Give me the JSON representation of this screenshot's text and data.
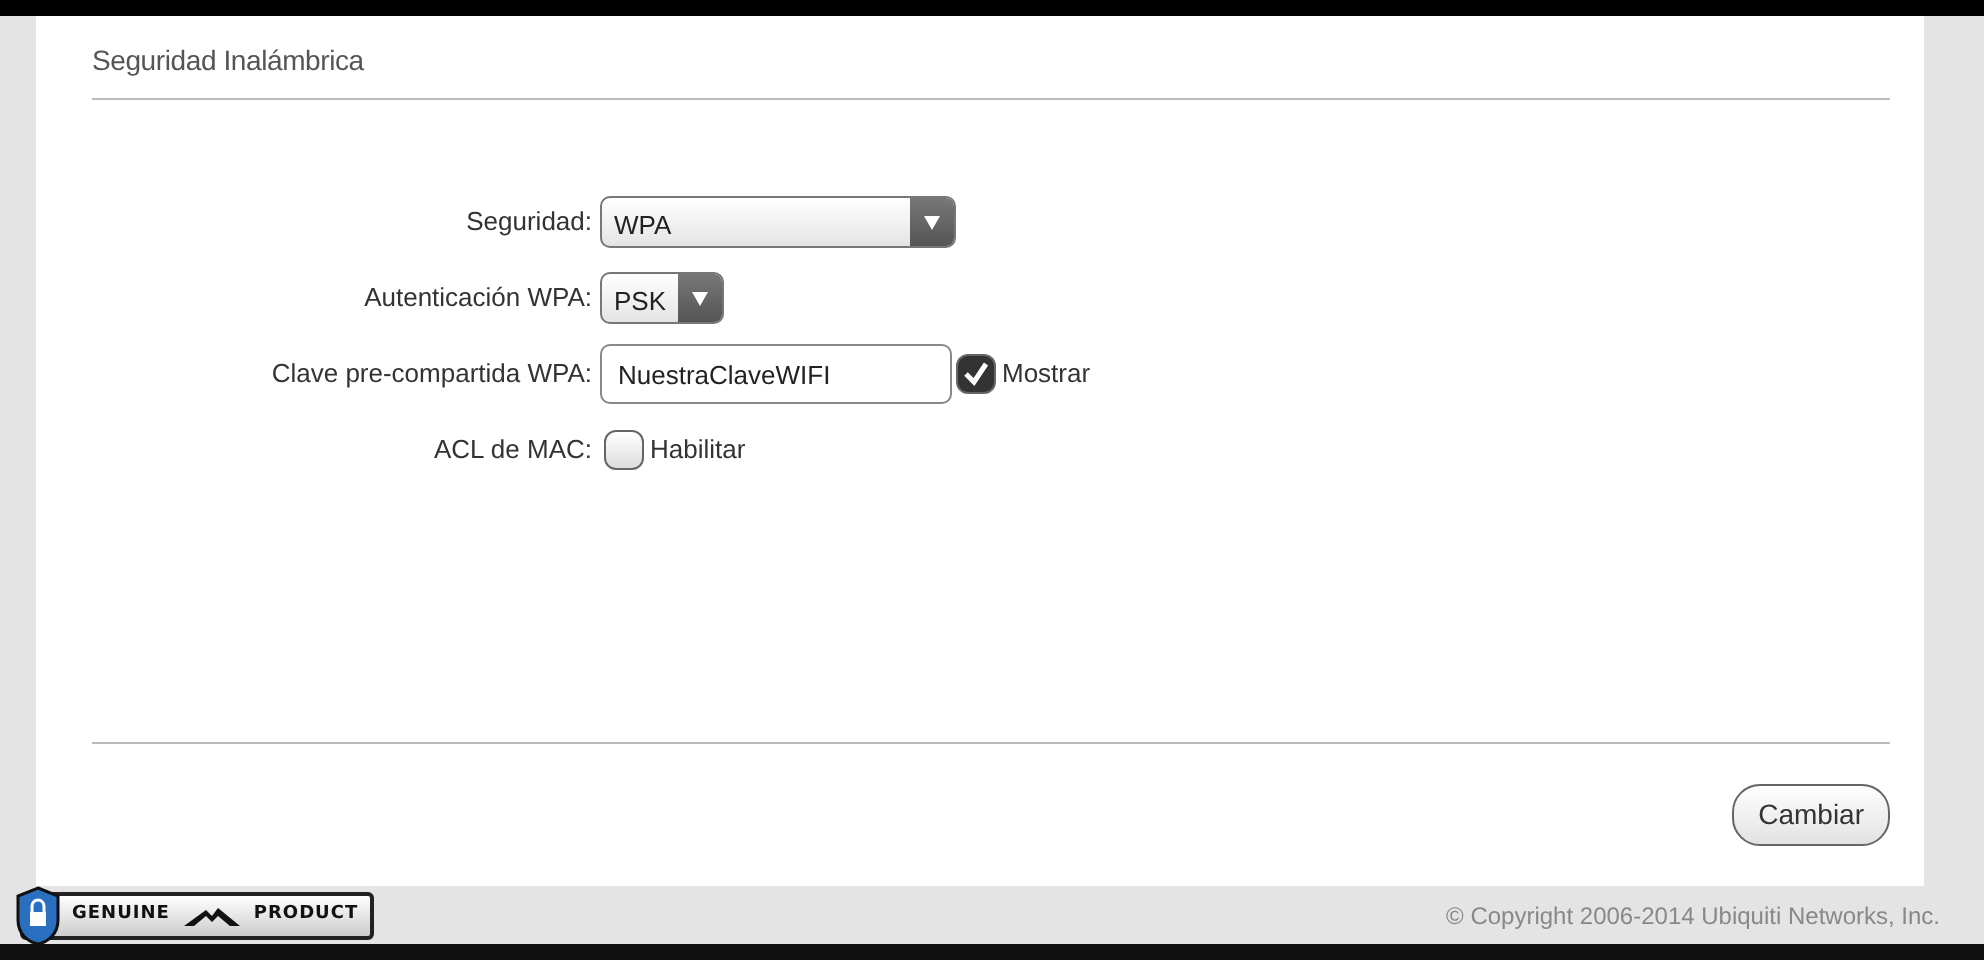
{
  "section": {
    "title": "Seguridad Inalámbrica"
  },
  "fields": [
    {
      "kind": "select",
      "label": "Seguridad:",
      "value": "WPA"
    },
    {
      "kind": "select",
      "label": "Autenticación WPA:",
      "value": "PSK"
    },
    {
      "kind": "input",
      "label": "Clave pre-compartida WPA:",
      "value": "NuestraClaveWIFI",
      "option": {
        "label": "Mostrar",
        "checked": true
      }
    },
    {
      "kind": "checkbox",
      "label": "ACL de MAC:",
      "option": {
        "label": "Habilitar",
        "checked": false
      }
    }
  ],
  "buttons": [
    "Cambiar"
  ],
  "footer": {
    "badge": [
      "GENUINE",
      "PRODUCT"
    ],
    "copyright": "© Copyright 2006-2014 Ubiquiti Networks, Inc."
  }
}
